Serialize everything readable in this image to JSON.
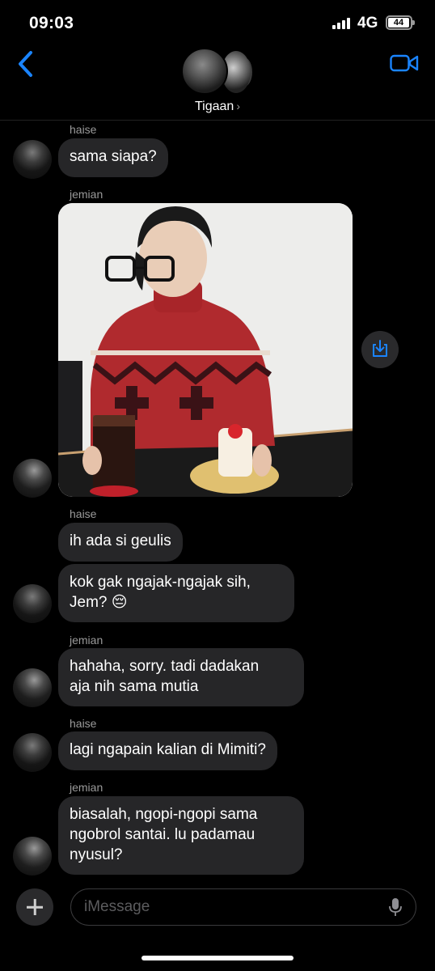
{
  "status_bar": {
    "time": "09:03",
    "network": "4G",
    "battery": "44"
  },
  "header": {
    "group_name": "Tigaan",
    "chevron": "›"
  },
  "messages": [
    {
      "sender": "haise",
      "text": "sama siapa?"
    },
    {
      "sender": "jemian",
      "type": "image"
    },
    {
      "sender": "haise",
      "text": "ih ada si geulis"
    },
    {
      "text_line1": "kok gak ngajak-ngajak sih,",
      "text_line2": "Jem? 😔"
    },
    {
      "sender": "jemian",
      "text_line1": "hahaha, sorry. tadi dadakan",
      "text_line2": "aja nih sama mutia"
    },
    {
      "sender": "haise",
      "text": "lagi ngapain kalian di Mimiti?"
    },
    {
      "sender": "jemian",
      "text_line1": "biasalah, ngopi-ngopi sama",
      "text_line2": "ngobrol santai. lu padamau",
      "text_line3": "nyusul?"
    }
  ],
  "composer": {
    "placeholder": "iMessage"
  },
  "icons": {
    "back": "chevron-left-icon",
    "video": "video-camera-icon",
    "save": "share-download-icon",
    "add": "plus-icon",
    "mic": "microphone-icon"
  },
  "colors": {
    "accent": "#1a84ff",
    "bubble": "#262628",
    "background": "#000000",
    "secondary_text": "#9a9a9a"
  }
}
